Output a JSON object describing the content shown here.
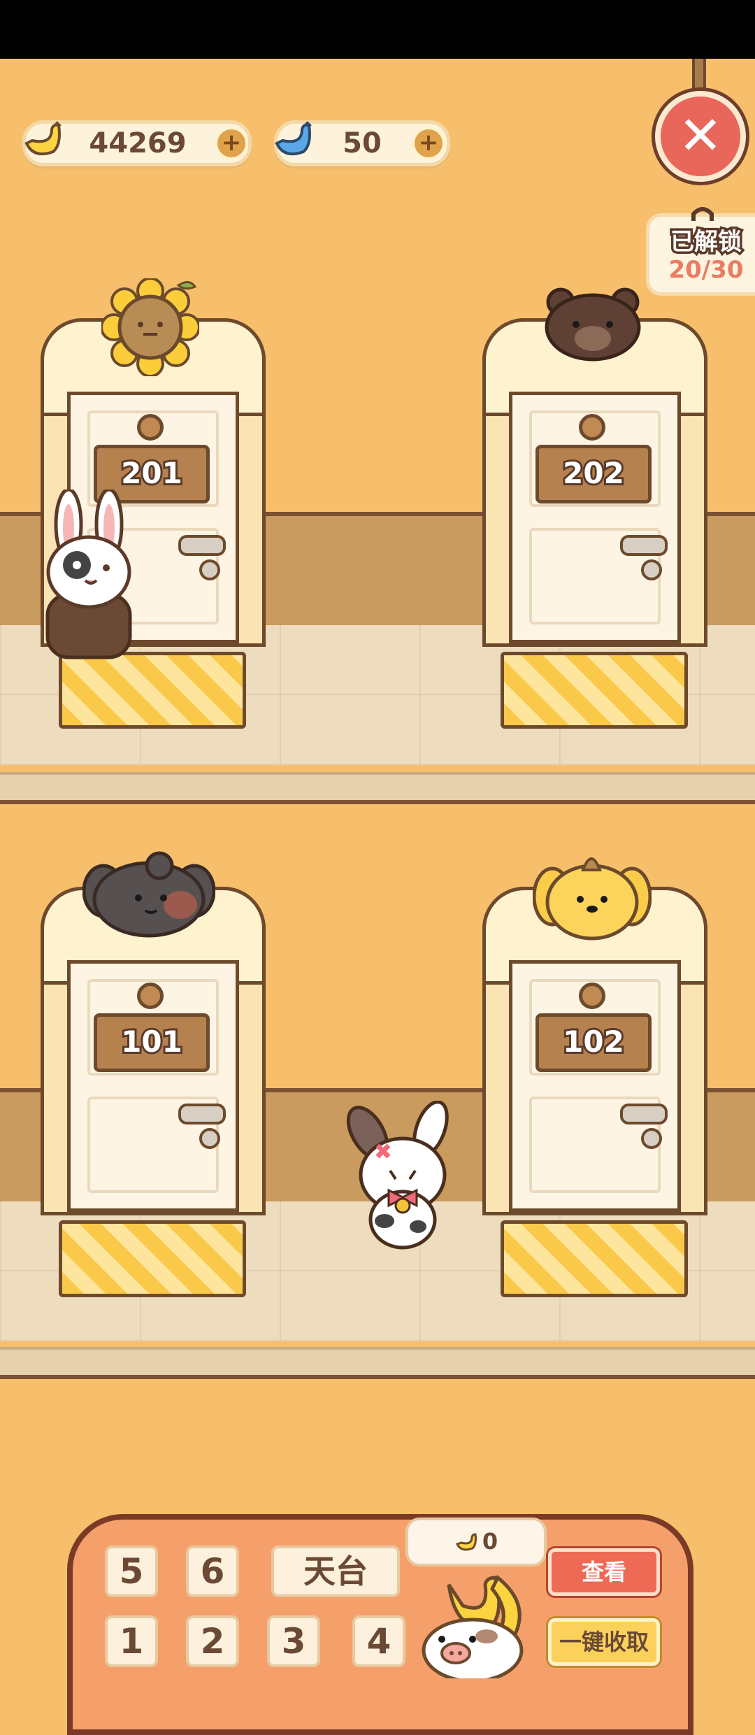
{
  "currency": {
    "banana": {
      "value": "44269",
      "icon": "banana-icon",
      "add": "+"
    },
    "blue_banana": {
      "value": "50",
      "icon": "blue-banana-icon",
      "add": "+"
    }
  },
  "close": {
    "icon": "close-icon",
    "label": "✕"
  },
  "unlock": {
    "title": "已解锁",
    "count": "20/30",
    "icon": "lock-icon"
  },
  "rooms": [
    {
      "number": "201"
    },
    {
      "number": "202"
    },
    {
      "number": "101"
    },
    {
      "number": "102"
    }
  ],
  "panel": {
    "floors_top": [
      "5",
      "6"
    ],
    "rooftop": "天台",
    "floors_bottom": [
      "1",
      "2",
      "3",
      "4"
    ],
    "view_label": "查看",
    "collect_label": "一键收取",
    "bubble_count": "0"
  },
  "colors": {
    "background": "#f7bf6c",
    "accent_red": "#ee6a55",
    "accent_yellow": "#fbd15c",
    "outline": "#6e4a2c"
  }
}
